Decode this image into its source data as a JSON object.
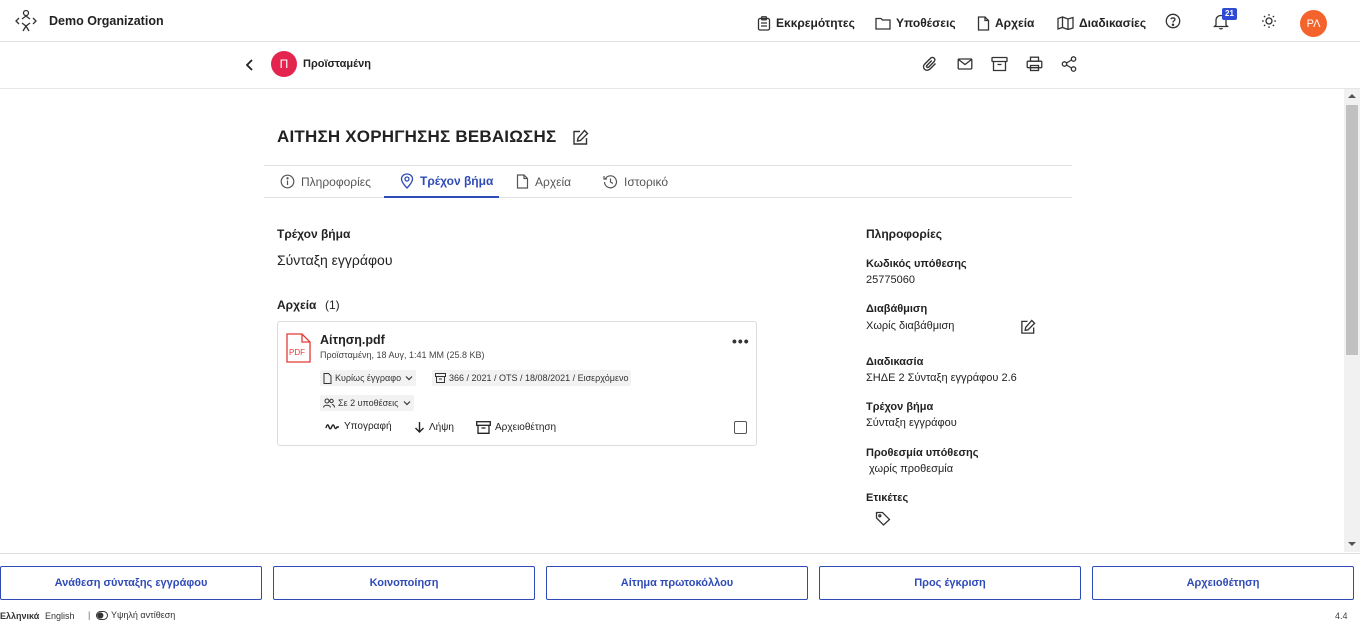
{
  "header": {
    "org_name": "Demo Organization",
    "nav": [
      {
        "label": "Εκκρεμότητες",
        "icon": "clipboard-icon"
      },
      {
        "label": "Υποθέσεις",
        "icon": "folder-icon"
      },
      {
        "label": "Αρχεία",
        "icon": "file-icon"
      },
      {
        "label": "Διαδικασίες",
        "icon": "map-icon"
      }
    ],
    "notifications_count": "21",
    "user_initials": "ΡΛ"
  },
  "subheader": {
    "role_initial": "Π",
    "role_name": "Προϊσταμένη"
  },
  "case": {
    "title": "ΑΙΤΗΣΗ ΧΟΡΗΓΗΣΗΣ ΒΕΒΑΙΩΣΗΣ"
  },
  "tabs": [
    {
      "label": "Πληροφορίες",
      "active": false
    },
    {
      "label": "Τρέχον βήμα",
      "active": true
    },
    {
      "label": "Αρχεία",
      "active": false
    },
    {
      "label": "Ιστορικό",
      "active": false
    }
  ],
  "current_step": {
    "heading": "Τρέχον βήμα",
    "value": "Σύνταξη εγγράφου"
  },
  "files": {
    "heading": "Αρχεία",
    "count": "(1)",
    "items": [
      {
        "name": "Αίτηση.pdf",
        "meta": "Προϊσταμένη,  18 Αυγ, 1:41 ΜΜ (25.8 KB)",
        "type_chip": "Κυρίως έγγραφο",
        "protocol_chip": "366 / 2021 / OTS / 18/08/2021 / Εισερχόμενο",
        "cases_chip": "Σε 2 υποθέσεις",
        "actions": [
          "Υπογραφή",
          "Λήψη",
          "Αρχειοθέτηση"
        ],
        "pdf_label": "PDF"
      }
    ]
  },
  "info": {
    "heading": "Πληροφορίες",
    "fields": [
      {
        "label": "Κωδικός υπόθεσης",
        "value": "25775060"
      },
      {
        "label": "Διαβάθμιση",
        "value": "Χωρίς διαβάθμιση"
      },
      {
        "label": "Διαδικασία",
        "value": "ΣΗΔΕ 2 Σύνταξη εγγράφου 2.6"
      },
      {
        "label": "Τρέχον βήμα",
        "value": "Σύνταξη εγγράφου"
      },
      {
        "label": "Προθεσμία υπόθεσης",
        "value": " χωρίς προθεσμία"
      },
      {
        "label": "Ετικέτες",
        "value": ""
      }
    ]
  },
  "actions": [
    "Ανάθεση σύνταξης εγγράφου",
    "Κοινοποίηση",
    "Αίτημα πρωτοκόλλου",
    "Προς έγκριση",
    "Αρχειοθέτηση"
  ],
  "footer": {
    "lang_el": "Ελληνικά",
    "lang_en": "English",
    "separator": "|",
    "high_contrast": "Υψηλή αντίθεση",
    "version": "4.4"
  },
  "colors": {
    "accent": "#2f4bb6",
    "avatar_user": "#f4632c",
    "avatar_role": "#e3244f",
    "badge": "#2f4bd6",
    "pdf_red": "#e53935"
  }
}
